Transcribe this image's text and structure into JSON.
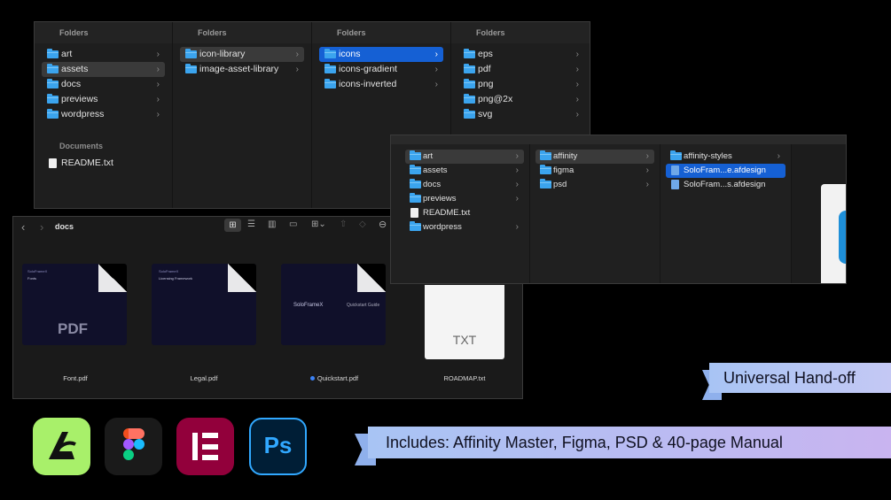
{
  "finder_top": {
    "columns": [
      {
        "header": "Folders",
        "items": [
          {
            "label": "art",
            "type": "folder",
            "selected": false
          },
          {
            "label": "assets",
            "type": "folder",
            "selected": true
          },
          {
            "label": "docs",
            "type": "folder",
            "selected": false
          },
          {
            "label": "previews",
            "type": "folder",
            "selected": false
          },
          {
            "label": "wordpress",
            "type": "folder",
            "selected": false
          }
        ],
        "section": "Documents",
        "section_items": [
          {
            "label": "README.txt",
            "type": "file"
          }
        ]
      },
      {
        "header": "Folders",
        "items": [
          {
            "label": "icon-library",
            "type": "folder",
            "selected": true
          },
          {
            "label": "image-asset-library",
            "type": "folder",
            "selected": false
          }
        ]
      },
      {
        "header": "Folders",
        "items": [
          {
            "label": "icons",
            "type": "folder",
            "selected": true,
            "active": true
          },
          {
            "label": "icons-gradient",
            "type": "folder",
            "selected": false
          },
          {
            "label": "icons-inverted",
            "type": "folder",
            "selected": false
          }
        ]
      },
      {
        "header": "Folders",
        "items": [
          {
            "label": "eps",
            "type": "folder"
          },
          {
            "label": "pdf",
            "type": "folder"
          },
          {
            "label": "png",
            "type": "folder"
          },
          {
            "label": "png@2x",
            "type": "folder"
          },
          {
            "label": "svg",
            "type": "folder"
          }
        ]
      }
    ]
  },
  "finder_right": {
    "col1": [
      {
        "label": "art",
        "type": "folder",
        "selected": true
      },
      {
        "label": "assets",
        "type": "folder"
      },
      {
        "label": "docs",
        "type": "folder"
      },
      {
        "label": "previews",
        "type": "folder"
      },
      {
        "label": "README.txt",
        "type": "file"
      },
      {
        "label": "wordpress",
        "type": "folder"
      }
    ],
    "col2": [
      {
        "label": "affinity",
        "type": "folder",
        "selected": true
      },
      {
        "label": "figma",
        "type": "folder"
      },
      {
        "label": "psd",
        "type": "folder"
      }
    ],
    "col3": [
      {
        "label": "affinity-styles",
        "type": "folder"
      },
      {
        "label": "SoloFram...e.afdesign",
        "type": "afdesign",
        "active": true
      },
      {
        "label": "SoloFram...s.afdesign",
        "type": "afdesign"
      }
    ]
  },
  "finder_icons": {
    "title": "docs",
    "files": [
      {
        "name": "Font.pdf",
        "badge": "PDF",
        "heading": "SoloFrameX",
        "sub": "Fonts"
      },
      {
        "name": "Legal.pdf",
        "heading": "SoloFrameX",
        "sub": "Licensing Framework"
      },
      {
        "name": "Quickstart.pdf",
        "heading": "SoloFrameX",
        "sub": "Quickstart Guide",
        "tagged": true
      },
      {
        "name": "ROADMAP.txt",
        "badge": "TXT"
      }
    ]
  },
  "apps": [
    "affinity-icon",
    "figma-icon",
    "elementor-icon",
    "photoshop-icon"
  ],
  "ribbons": {
    "handoff": "Universal Hand-off",
    "includes": "Includes: Affinity Master, Figma, PSD & 40-page Manual"
  },
  "colors": {
    "accent_blue": "#1560d4",
    "folder_blue": "#3ba4ee",
    "ribbon_start": "#a8c4f4",
    "ribbon_end": "#c9b4f0"
  }
}
